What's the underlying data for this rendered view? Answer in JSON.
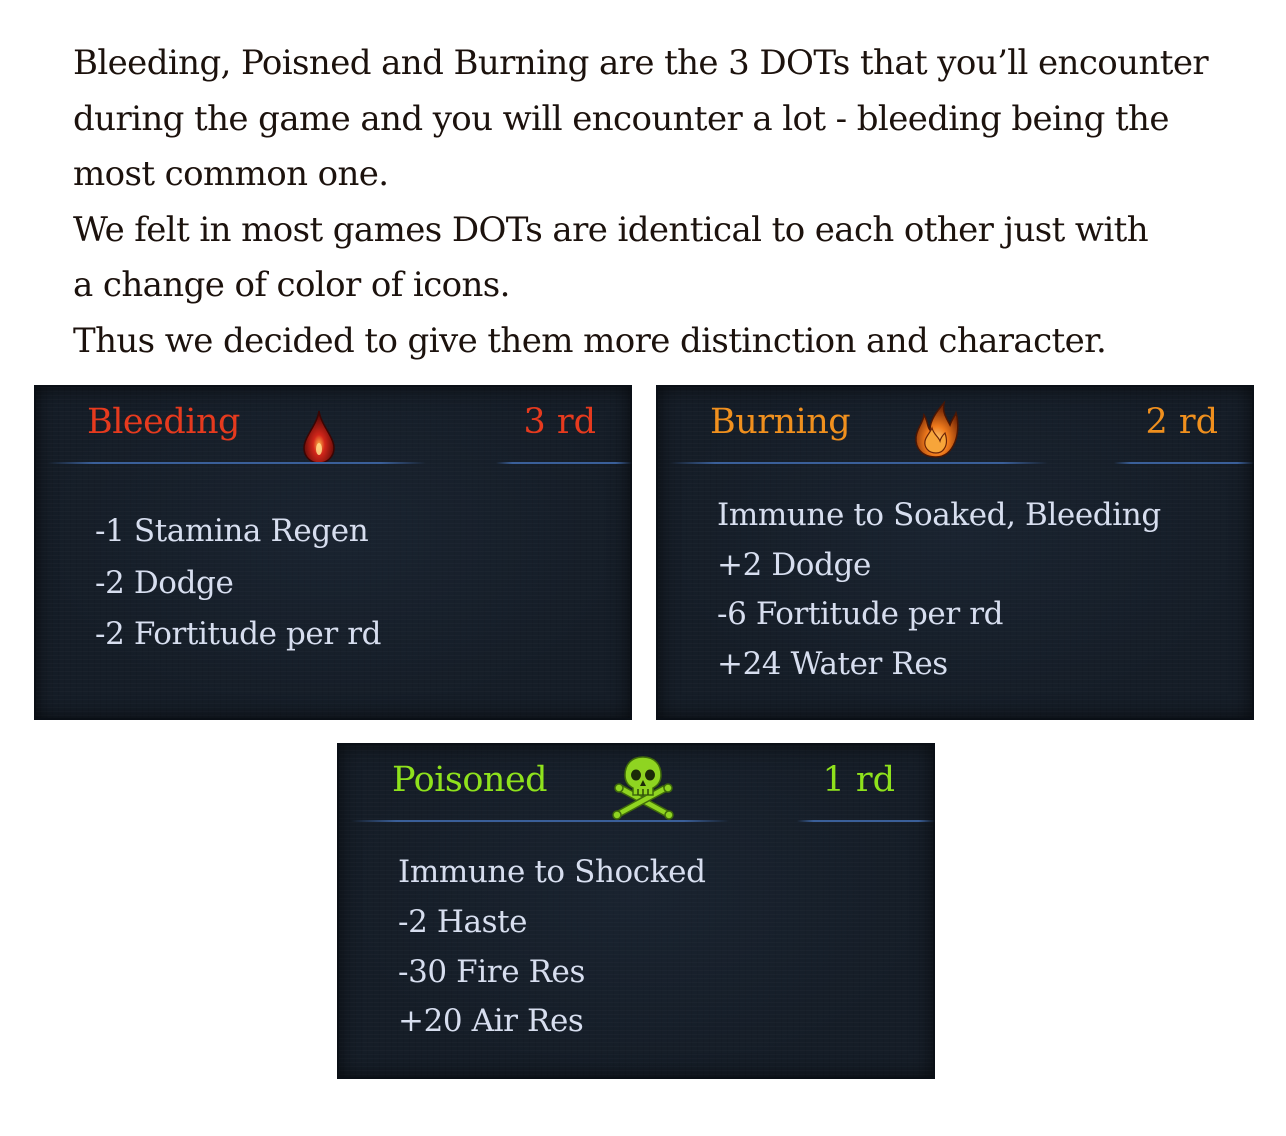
{
  "intro": {
    "lines": [
      "Bleeding, Poisned and Burning are the 3 DOTs that you’ll encounter",
      "during the game and you will encounter a lot - bleeding being the",
      "most common one.",
      "We felt in most games DOTs are identical to each other just with",
      "a change of color of icons.",
      "Thus we decided to give them more distinction and character."
    ]
  },
  "panels": {
    "bleeding": {
      "title": "Bleeding",
      "duration": "3 rd",
      "title_color": "#e63a1e",
      "icon": "blood-drop-icon",
      "effects": [
        "-1 Stamina Regen",
        "-2 Dodge",
        "-2 Fortitude per rd"
      ]
    },
    "burning": {
      "title": "Burning",
      "duration": "2 rd",
      "title_color": "#f0901e",
      "icon": "flame-icon",
      "effects": [
        "Immune to Soaked, Bleeding",
        "+2 Dodge",
        "-6 Fortitude per rd",
        "+24 Water Res"
      ]
    },
    "poisoned": {
      "title": "Poisoned",
      "duration": "1 rd",
      "title_color": "#8fe21c",
      "icon": "skull-crossbones-icon",
      "effects": [
        "Immune to Shocked",
        "-2 Haste",
        "-30 Fire Res",
        "+20 Air Res"
      ]
    }
  },
  "colors": {
    "panel_background": "#151d27",
    "effect_text": "#d7deef",
    "separator": "#3a5f99",
    "intro_text": "#1c120d"
  }
}
